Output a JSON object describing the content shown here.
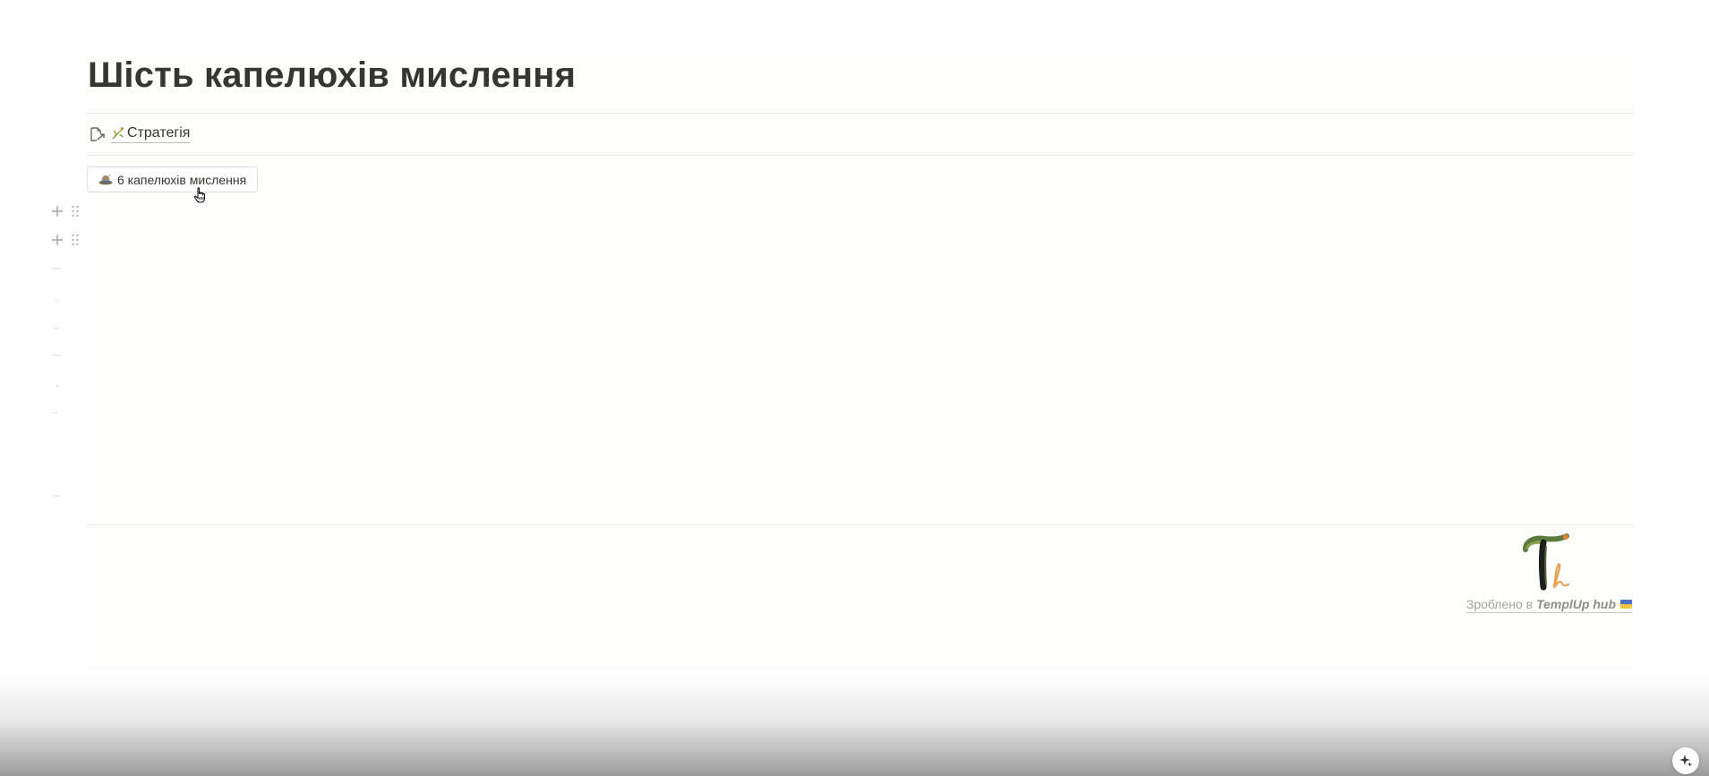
{
  "page": {
    "title": "Шість капелюхів мислення"
  },
  "relation": {
    "icon": "page-link-arrow-icon",
    "item_icon": "leaf-icon",
    "label": "Стратегія"
  },
  "action_button": {
    "icon": "hat-icon",
    "label": "6 капелюхів мислення"
  },
  "block_controls": {
    "add_icon": "plus-icon",
    "drag_icon": "drag-handle-icon"
  },
  "footer": {
    "logo": "templup-logo",
    "credit_prefix": "Зроблено в",
    "credit_brand": "TemplUp hub",
    "flag_icon": "ukraine-flag-icon"
  },
  "ai_button": {
    "icon": "sparkle-icon"
  },
  "colors": {
    "text": "#37352f",
    "divider": "#e9e9e7",
    "muted": "#a3a29e",
    "flag_blue": "#4d6ec7",
    "flag_yellow": "#f1c741"
  }
}
